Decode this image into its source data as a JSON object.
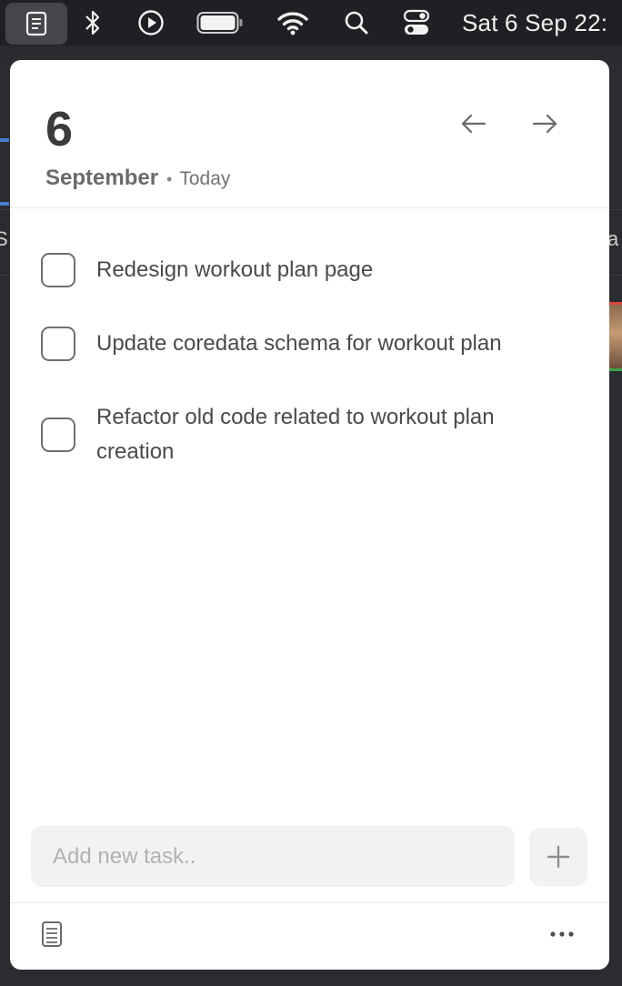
{
  "menubar": {
    "clock": "Sat 6 Sep  22:",
    "icons": [
      "notes-app-icon",
      "bluetooth-icon",
      "play-icon",
      "battery-icon",
      "wifi-icon",
      "search-icon",
      "control-center-icon"
    ]
  },
  "background": {
    "left_letter": "S",
    "right_letter": "a"
  },
  "panel": {
    "day": "6",
    "month": "September",
    "separator": "•",
    "relative": "Today",
    "tasks": [
      {
        "label": "Redesign workout plan page",
        "done": false
      },
      {
        "label": "Update coredata schema for workout plan",
        "done": false
      },
      {
        "label": "Refactor old code related to workout plan creation",
        "done": false
      }
    ],
    "add_placeholder": "Add new task..",
    "add_icon": "plus-icon",
    "footer_left_icon": "list-icon",
    "footer_right_icon": "ellipsis-icon"
  },
  "colors": {
    "menubar_bg": "#1f2023",
    "panel_bg": "#ffffff",
    "text_primary": "#3b3b3d",
    "checkbox_border": "#6e6e72",
    "input_bg": "#f2f2f3"
  }
}
